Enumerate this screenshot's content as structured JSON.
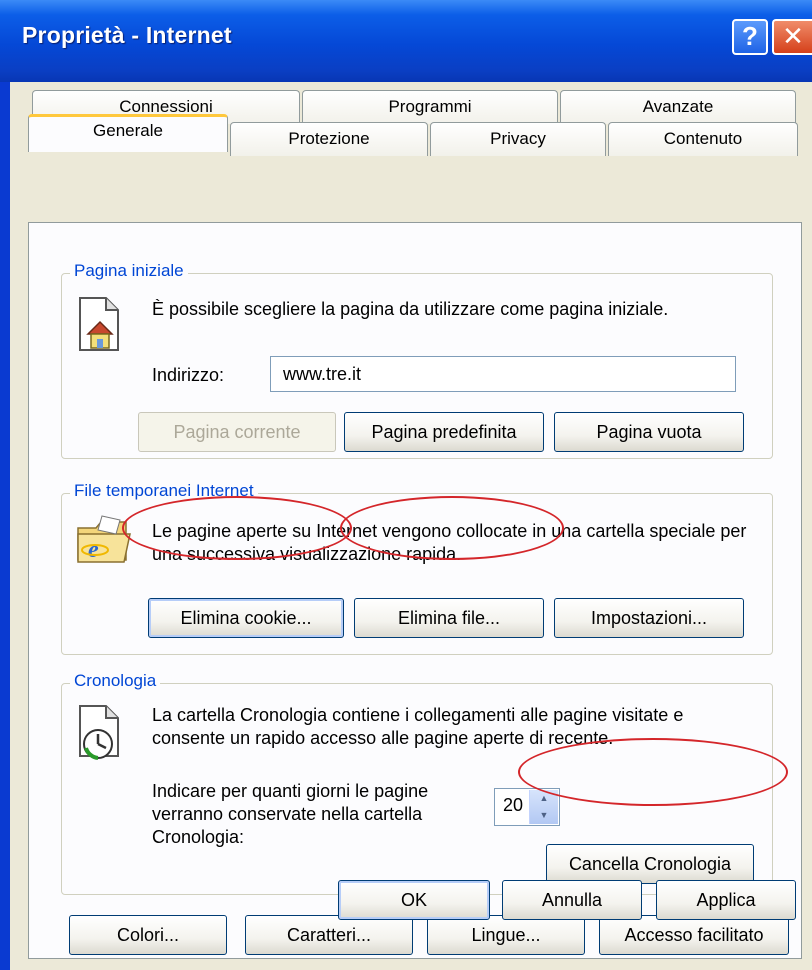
{
  "window": {
    "title": "Proprietà - Internet",
    "help_label": "?",
    "close_label": "✕"
  },
  "tabs": {
    "row1": [
      "Connessioni",
      "Programmi",
      "Avanzate"
    ],
    "row2": [
      "Generale",
      "Protezione",
      "Privacy",
      "Contenuto"
    ],
    "active": "Generale"
  },
  "home_page": {
    "label": "Pagina iniziale",
    "description": "È possibile scegliere la pagina da utilizzare come pagina iniziale.",
    "address_label": "Indirizzo:",
    "address_value": "www.tre.it",
    "buttons": {
      "current": "Pagina corrente",
      "default": "Pagina predefinita",
      "blank": "Pagina vuota"
    }
  },
  "temp_files": {
    "label": "File temporanei Internet",
    "description": "Le pagine aperte su Internet vengono collocate in una cartella speciale per una successiva visualizzazione rapida.",
    "buttons": {
      "delete_cookies": "Elimina cookie...",
      "delete_files": "Elimina file...",
      "settings": "Impostazioni..."
    }
  },
  "history": {
    "label": "Cronologia",
    "description": "La cartella Cronologia contiene i collegamenti alle pagine visitate e consente un rapido accesso alle pagine aperte di recente.",
    "days_label": "Indicare per quanti giorni le pagine verranno conservate nella cartella Cronologia:",
    "days_value": "20",
    "clear_button": "Cancella Cronologia"
  },
  "bottom_buttons": {
    "colors": "Colori...",
    "fonts": "Caratteri...",
    "languages": "Lingue...",
    "accessibility": "Accesso facilitato"
  },
  "dialog_buttons": {
    "ok": "OK",
    "cancel": "Annulla",
    "apply": "Applica"
  },
  "annotations": {
    "color": "#d4262a"
  },
  "icons": {
    "home": "home-page-icon",
    "temp": "ie-folder-icon",
    "history": "history-clock-icon"
  }
}
